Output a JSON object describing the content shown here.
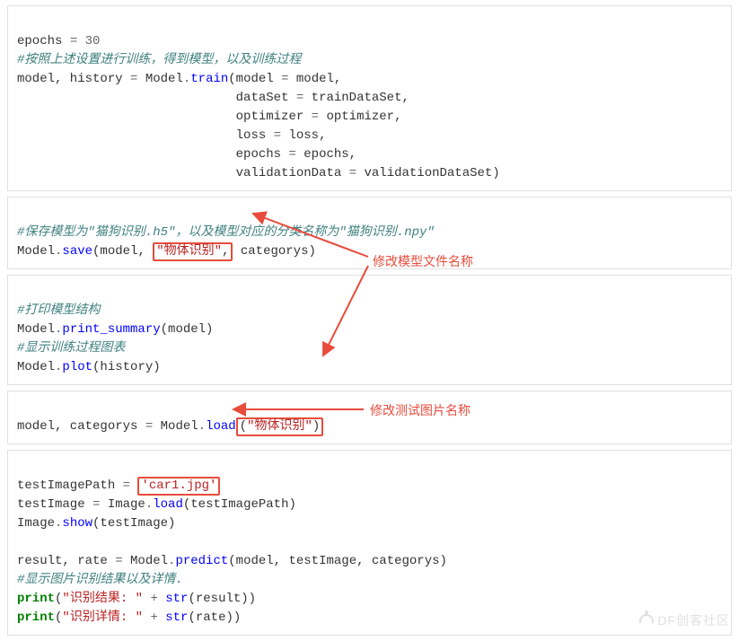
{
  "block1": {
    "l1a": "epochs ",
    "l1b": "= ",
    "l1c": "30",
    "l2": "#按照上述设置进行训练，得到模型，以及训练过程",
    "l3a": "model, history ",
    "l3b": "= ",
    "l3c": "Model",
    "l3d": ".",
    "l3e": "train",
    "l3f": "(model ",
    "l3g": "= ",
    "l3h": "model,",
    "l4a": "                             dataSet ",
    "l4b": "= ",
    "l4c": "trainDataSet,",
    "l5a": "                             optimizer ",
    "l5b": "= ",
    "l5c": "optimizer,",
    "l6a": "                             loss ",
    "l6b": "= ",
    "l6c": "loss,",
    "l7a": "                             epochs ",
    "l7b": "= ",
    "l7c": "epochs,",
    "l8a": "                             validationData ",
    "l8b": "= ",
    "l8c": "validationDataSet)"
  },
  "block2": {
    "l1": "#保存模型为\"猫狗识别.h5\"，以及模型对应的分类名称为\"猫狗识别.npy\"",
    "l2a": "Model",
    "l2b": ".",
    "l2c": "save",
    "l2d": "(model, ",
    "l2e": "\"物体识别\"",
    "l2f": ",",
    "l2g": " categorys)"
  },
  "block3": {
    "l1": "#打印模型结构",
    "l2a": "Model",
    "l2b": ".",
    "l2c": "print_summary",
    "l2d": "(model)",
    "l3": "#显示训练过程图表",
    "l4a": "Model",
    "l4b": ".",
    "l4c": "plot",
    "l4d": "(history)"
  },
  "block4": {
    "l1a": "model, categorys ",
    "l1b": "= ",
    "l1c": "Model",
    "l1d": ".",
    "l1e": "load",
    "l1f": "(",
    "l1g": "\"物体识别\"",
    "l1h": ")"
  },
  "block5": {
    "l1a": "testImagePath ",
    "l1b": "= ",
    "l1c": "'car1.jpg'",
    "l2a": "testImage ",
    "l2b": "= ",
    "l2c": "Image",
    "l2d": ".",
    "l2e": "load",
    "l2f": "(testImagePath)",
    "l3a": "Image",
    "l3b": ".",
    "l3c": "show",
    "l3d": "(testImage)",
    "blank": "",
    "l4a": "result, rate ",
    "l4b": "= ",
    "l4c": "Model",
    "l4d": ".",
    "l4e": "predict",
    "l4f": "(model, testImage, categorys)",
    "l5": "#显示图片识别结果以及详情.",
    "l6a": "print",
    "l6b": "(",
    "l6c": "\"识别结果: \"",
    "l6d": " ",
    "l6e": "+",
    "l6f": " ",
    "l6g": "str",
    "l6h": "(result))",
    "l7a": "print",
    "l7b": "(",
    "l7c": "\"识别详情: \"",
    "l7d": " ",
    "l7e": "+",
    "l7f": " ",
    "l7g": "str",
    "l7h": "(rate))"
  },
  "annotations": {
    "model_filename": "修改模型文件名称",
    "test_image": "修改测试图片名称"
  },
  "watermark": "DF创客社区",
  "chart_data": {
    "type": "table",
    "description": "Annotated Python/Mind+ code screenshot for training and loading an image classification model; red boxes highlight editable strings",
    "highlights": [
      {
        "block": 2,
        "line": 2,
        "text": "\"物体识别\",",
        "label": "修改模型文件名称"
      },
      {
        "block": 4,
        "line": 1,
        "text": "(\"物体识别\")",
        "label": "修改模型文件名称"
      },
      {
        "block": 5,
        "line": 1,
        "text": "'car1.jpg'",
        "label": "修改测试图片名称"
      }
    ],
    "code_summary": {
      "epochs": 30,
      "train_call": "Model.train(model=model, dataSet=trainDataSet, optimizer=optimizer, loss=loss, epochs=epochs, validationData=validationDataSet)",
      "save_call": "Model.save(model, \"物体识别\", categorys)",
      "load_call": "Model.load(\"物体识别\")",
      "test_image_path": "car1.jpg",
      "predict_call": "Model.predict(model, testImage, categorys)"
    }
  }
}
